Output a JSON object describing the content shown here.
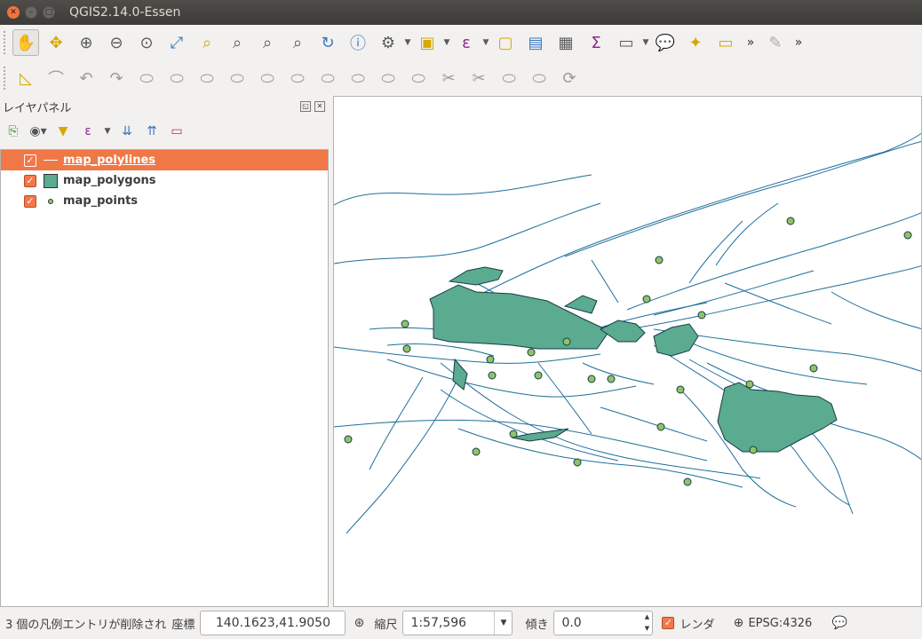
{
  "window": {
    "title": "QGIS2.14.0-Essen"
  },
  "toolbar1": {
    "icons": [
      "pan-icon",
      "pan-to-selection-icon",
      "zoom-in-icon",
      "zoom-out-icon",
      "zoom-actual-icon",
      "zoom-full-icon",
      "zoom-to-selection-icon",
      "zoom-to-layer-icon",
      "zoom-last-icon",
      "zoom-next-icon",
      "refresh-icon",
      "identify-icon",
      "action-icon",
      "select-icon",
      "expression-select-icon",
      "deselect-icon",
      "attribute-table-icon",
      "field-calculator-icon",
      "statistics-icon",
      "measure-icon",
      "annotation-icon",
      "new-bookmark-icon",
      "show-bookmarks-icon"
    ],
    "overflow": "»"
  },
  "toolbar2": {
    "overflow": "»"
  },
  "layer_panel": {
    "title": "レイヤパネル",
    "layers": [
      {
        "name": "map_polylines",
        "checked": true,
        "selected": true,
        "symbol": "line"
      },
      {
        "name": "map_polygons",
        "checked": true,
        "selected": false,
        "symbol": "polygon"
      },
      {
        "name": "map_points",
        "checked": true,
        "selected": false,
        "symbol": "point"
      }
    ]
  },
  "map": {
    "polygon_fill": "#5aab8f",
    "line_color": "#1f6f9a",
    "point_fill": "#8dc466"
  },
  "status": {
    "message": "3 個の凡例エントリが削除され",
    "coord_label": "座標",
    "coordinate": "140.1623,41.9050",
    "scale_label": "縮尺",
    "scale": "1:57,596",
    "rotation_label": "傾き",
    "rotation": "0.0",
    "render_label": "レンダ",
    "crs": "EPSG:4326"
  },
  "colors": {
    "accent": "#f07746",
    "titlebar": "#3c3b37"
  }
}
